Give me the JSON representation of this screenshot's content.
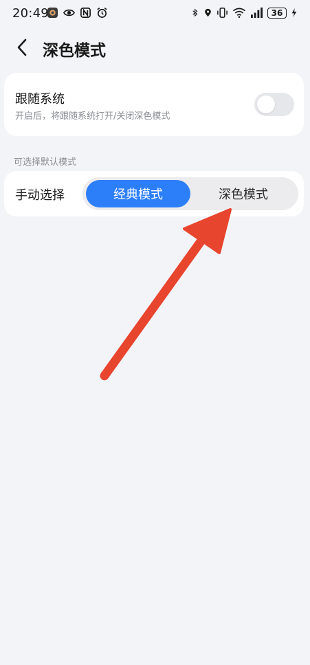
{
  "status_bar": {
    "time": "20:49",
    "battery": "36",
    "left_icons": [
      "app-icon",
      "eye-icon",
      "nfc-icon",
      "alarm-icon"
    ],
    "right_icons": [
      "bluetooth-icon",
      "location-icon",
      "vibrate-icon",
      "wifi-icon",
      "signal-icon",
      "battery-icon",
      "charging-icon"
    ]
  },
  "header": {
    "title": "深色模式",
    "back_icon": "chevron-left-icon"
  },
  "follow_system": {
    "title": "跟随系统",
    "description": "开启后，将跟随系统打开/关闭深色模式",
    "enabled": false
  },
  "default_mode": {
    "section_label": "可选择默认模式",
    "manual_label": "手动选择",
    "options": [
      "经典模式",
      "深色模式"
    ],
    "selected": "经典模式"
  },
  "colors": {
    "accent": "#2d7ff9",
    "background": "#f3f4f8",
    "card": "#ffffff",
    "annotation_arrow": "#e8452f"
  }
}
